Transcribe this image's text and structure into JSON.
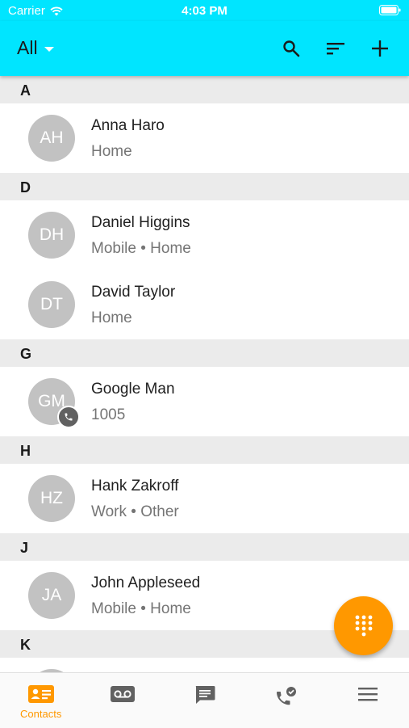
{
  "status": {
    "carrier": "Carrier",
    "time": "4:03 PM"
  },
  "header": {
    "filter": "All",
    "icons": [
      "search-icon",
      "sort-icon",
      "add-icon"
    ]
  },
  "sections": [
    {
      "letter": "A",
      "contacts": [
        {
          "initials": "AH",
          "name": "Anna Haro",
          "detail": "Home"
        }
      ]
    },
    {
      "letter": "D",
      "contacts": [
        {
          "initials": "DH",
          "name": "Daniel Higgins",
          "detail": "Mobile • Home"
        },
        {
          "initials": "DT",
          "name": "David Taylor",
          "detail": "Home"
        }
      ]
    },
    {
      "letter": "G",
      "contacts": [
        {
          "initials": "GM",
          "name": "Google Man",
          "detail": "1005",
          "badge": "phone-icon"
        }
      ]
    },
    {
      "letter": "H",
      "contacts": [
        {
          "initials": "HZ",
          "name": "Hank Zakroff",
          "detail": "Work • Other"
        }
      ]
    },
    {
      "letter": "J",
      "contacts": [
        {
          "initials": "JA",
          "name": "John Appleseed",
          "detail": "Mobile • Home"
        }
      ]
    },
    {
      "letter": "K",
      "contacts": [
        {
          "initials": "",
          "name": "",
          "detail": ""
        }
      ]
    }
  ],
  "fab": {
    "icon": "dialpad-icon"
  },
  "tabs": [
    {
      "label": "Contacts",
      "icon": "contacts-icon",
      "active": true
    },
    {
      "label": "",
      "icon": "voicemail-icon"
    },
    {
      "label": "",
      "icon": "messages-icon"
    },
    {
      "label": "",
      "icon": "call-history-icon"
    },
    {
      "label": "",
      "icon": "menu-icon"
    }
  ],
  "colors": {
    "accent": "#00e5ff",
    "fab": "#ff9800",
    "avatar": "#c2c2c2",
    "section_bg": "#ebebeb"
  }
}
